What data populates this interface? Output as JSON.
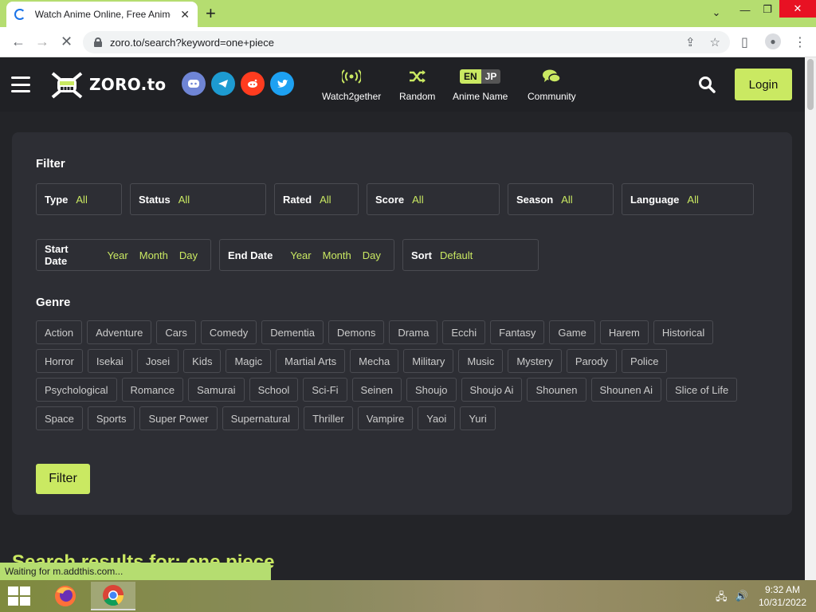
{
  "browser": {
    "tab_title": "Watch Anime Online, Free Anime",
    "url": "zoro.to/search?keyword=one+piece",
    "status_text": "Waiting for m.addthis.com..."
  },
  "site": {
    "logo_text": "ZORO.to",
    "nav": [
      {
        "label": "Watch2gether"
      },
      {
        "label": "Random"
      },
      {
        "label": "Anime Name"
      },
      {
        "label": "Community"
      }
    ],
    "lang_en": "EN",
    "lang_jp": "JP",
    "login_label": "Login",
    "brand_color": "#cae962"
  },
  "filter": {
    "title": "Filter",
    "type": {
      "key": "Type",
      "value": "All"
    },
    "status": {
      "key": "Status",
      "value": "All"
    },
    "rated": {
      "key": "Rated",
      "value": "All"
    },
    "score": {
      "key": "Score",
      "value": "All"
    },
    "season": {
      "key": "Season",
      "value": "All"
    },
    "language": {
      "key": "Language",
      "value": "All"
    },
    "start_date": {
      "key": "Start Date",
      "year": "Year",
      "month": "Month",
      "day": "Day"
    },
    "end_date": {
      "key": "End Date",
      "year": "Year",
      "month": "Month",
      "day": "Day"
    },
    "sort": {
      "key": "Sort",
      "value": "Default"
    },
    "genre_title": "Genre",
    "genres": [
      [
        "Action",
        "Adventure",
        "Cars",
        "Comedy",
        "Dementia",
        "Demons",
        "Drama",
        "Ecchi",
        "Fantasy",
        "Game",
        "Harem",
        "Historical"
      ],
      [
        "Horror",
        "Isekai",
        "Josei",
        "Kids",
        "Magic",
        "Martial Arts",
        "Mecha",
        "Military",
        "Music",
        "Mystery",
        "Parody",
        "Police"
      ],
      [
        "Psychological",
        "Romance",
        "Samurai",
        "School",
        "Sci-Fi",
        "Seinen",
        "Shoujo",
        "Shoujo Ai",
        "Shounen",
        "Shounen Ai",
        "Slice of Life"
      ],
      [
        "Space",
        "Sports",
        "Super Power",
        "Supernatural",
        "Thriller",
        "Vampire",
        "Yaoi",
        "Yuri"
      ]
    ],
    "button_label": "Filter"
  },
  "results_title": "Search results for: one piece",
  "taskbar": {
    "time": "9:32 AM",
    "date": "10/31/2022"
  }
}
